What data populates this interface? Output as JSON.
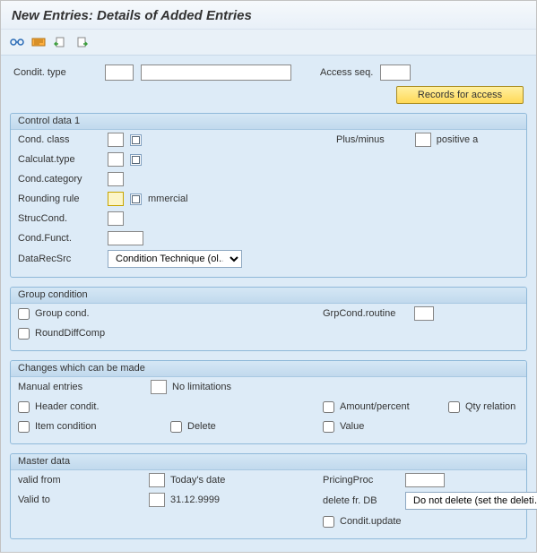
{
  "title": "New Entries: Details of Added Entries",
  "top": {
    "condit_type_label": "Condit. type",
    "condit_type_code": "",
    "condit_type_desc": "",
    "access_seq_label": "Access seq.",
    "access_seq": "",
    "records_button": "Records for access"
  },
  "control": {
    "title": "Control data 1",
    "cond_class_label": "Cond. class",
    "cond_class": "",
    "calc_type_label": "Calculat.type",
    "calc_type": "",
    "cond_category_label": "Cond.category",
    "cond_category": "",
    "rounding_rule_label": "Rounding rule",
    "rounding_rule": "",
    "rounding_rule_txt": "mmercial",
    "struc_cond_label": "StrucCond.",
    "struc_cond": "",
    "cond_funct_label": "Cond.Funct.",
    "cond_funct": "",
    "datarecsrc_label": "DataRecSrc",
    "datarecsrc": "Condition Technique (ol…",
    "plus_minus_label": "Plus/minus",
    "plus_minus": "",
    "plus_minus_txt": "positive a"
  },
  "group": {
    "title": "Group condition",
    "group_cond_label": "Group cond.",
    "rounddiff_label": "RoundDiffComp",
    "grpcondroutine_label": "GrpCond.routine",
    "grpcondroutine": ""
  },
  "changes": {
    "title": "Changes which can be made",
    "manual_entries_label": "Manual entries",
    "manual_entries": "",
    "manual_entries_txt": "No limitations",
    "header_condit_label": "Header condit.",
    "item_condition_label": "Item condition",
    "delete_label": "Delete",
    "amount_percent_label": "Amount/percent",
    "qty_relation_label": "Qty relation",
    "value_label": "Value"
  },
  "master": {
    "title": "Master data",
    "valid_from_label": "valid from",
    "valid_from": "",
    "valid_from_txt": "Today's date",
    "valid_to_label": "Valid to",
    "valid_to": "",
    "valid_to_txt": "31.12.9999",
    "pricingproc_label": "PricingProc",
    "pricingproc": "",
    "delete_db_label": "delete fr. DB",
    "delete_db": "Do not delete (set the deleti…",
    "condit_update_label": "Condit.update"
  }
}
